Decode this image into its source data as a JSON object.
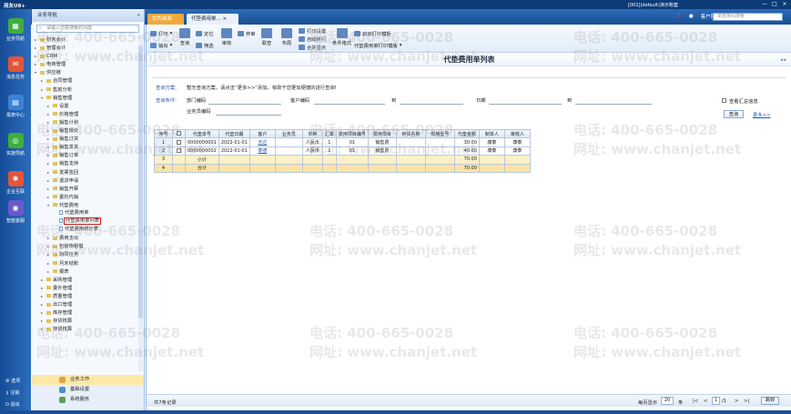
{
  "window": {
    "app_name": "用友U8+",
    "context": "[001](default)演示账套",
    "controls": [
      "—",
      "□",
      "×"
    ]
  },
  "topnav": {
    "tabs": [
      {
        "label": "我的桌面",
        "active": false
      },
      {
        "label": "代垫费用单... ×",
        "active": true
      }
    ],
    "messages_label": "客户服务",
    "search_placeholder": "单据条码搜索"
  },
  "iconbar": {
    "items": [
      {
        "label": "业务导航",
        "icon": "grid-icon",
        "color": "#3fae3f",
        "glyph": "▦"
      },
      {
        "label": "消息任务",
        "icon": "mail-icon",
        "color": "#e2553a",
        "glyph": "✉"
      },
      {
        "label": "报表中心",
        "icon": "report-icon",
        "color": "#3b82d6",
        "glyph": "▤"
      },
      {
        "label": "实施导航",
        "icon": "compass-icon",
        "color": "#3fae3f",
        "glyph": "◎"
      },
      {
        "label": "企业互联",
        "icon": "network-icon",
        "color": "#e2553a",
        "glyph": "✱"
      },
      {
        "label": "智能客服",
        "icon": "service-icon",
        "color": "#6a5acd",
        "glyph": "◉"
      }
    ],
    "bottom": [
      {
        "label": "选项",
        "icon": "gear-icon"
      },
      {
        "label": "注销",
        "icon": "key-icon"
      },
      {
        "label": "退出",
        "icon": "exit-icon"
      }
    ]
  },
  "tree": {
    "header": "业务导航",
    "search_placeholder": "请输入您要搜索的功能",
    "items": [
      {
        "label": "财务会计",
        "level": 1,
        "type": "node"
      },
      {
        "label": "管理会计",
        "level": 1,
        "type": "node"
      },
      {
        "label": "CRM",
        "level": 1,
        "type": "node"
      },
      {
        "label": "电商管理",
        "level": 1,
        "type": "node"
      },
      {
        "label": "供应链",
        "level": 1,
        "type": "open"
      },
      {
        "label": "合同管理",
        "level": 2,
        "type": "node"
      },
      {
        "label": "售前分析",
        "level": 2,
        "type": "node"
      },
      {
        "label": "销售管理",
        "level": 2,
        "type": "open"
      },
      {
        "label": "设置",
        "level": 3,
        "type": "node"
      },
      {
        "label": "价格管理",
        "level": 3,
        "type": "node"
      },
      {
        "label": "销售计划",
        "level": 3,
        "type": "node"
      },
      {
        "label": "销售报价",
        "level": 3,
        "type": "node"
      },
      {
        "label": "销售订货",
        "level": 3,
        "type": "node"
      },
      {
        "label": "销售发货",
        "level": 3,
        "type": "node"
      },
      {
        "label": "销售订单",
        "level": 3,
        "type": "node"
      },
      {
        "label": "销售支持",
        "level": 3,
        "type": "node"
      },
      {
        "label": "发票签回",
        "level": 3,
        "type": "node"
      },
      {
        "label": "退货申请",
        "level": 3,
        "type": "node"
      },
      {
        "label": "销售开票",
        "level": 3,
        "type": "node"
      },
      {
        "label": "委托代销",
        "level": 3,
        "type": "node"
      },
      {
        "label": "代垫费用",
        "level": 3,
        "type": "open"
      },
      {
        "label": "代垫费用单",
        "level": 4,
        "type": "doc"
      },
      {
        "label": "代垫费用单列表",
        "level": 4,
        "type": "doc",
        "selected": true
      },
      {
        "label": "代垫费用统计表",
        "level": 4,
        "type": "doc"
      },
      {
        "label": "费用支出",
        "level": 3,
        "type": "node"
      },
      {
        "label": "包装物租借",
        "level": 3,
        "type": "node"
      },
      {
        "label": "协同任务",
        "level": 3,
        "type": "node"
      },
      {
        "label": "月末结账",
        "level": 3,
        "type": "node"
      },
      {
        "label": "报表",
        "level": 3,
        "type": "node"
      },
      {
        "label": "采购管理",
        "level": 2,
        "type": "node"
      },
      {
        "label": "委外管理",
        "level": 2,
        "type": "node"
      },
      {
        "label": "质量管理",
        "level": 2,
        "type": "node"
      },
      {
        "label": "出口管理",
        "level": 2,
        "type": "node"
      },
      {
        "label": "库存管理",
        "level": 2,
        "type": "node"
      },
      {
        "label": "存货核算",
        "level": 2,
        "type": "node"
      },
      {
        "label": "存货核算",
        "level": 2,
        "type": "node"
      }
    ],
    "footer": [
      {
        "label": "业务工作",
        "active": true,
        "color": "#e6a23c"
      },
      {
        "label": "基础设置",
        "active": false,
        "color": "#4a90d9"
      },
      {
        "label": "系统服务",
        "active": false,
        "color": "#5aa05a"
      }
    ]
  },
  "toolbar": {
    "print": "打印",
    "output": "输出",
    "query": "查询",
    "locate": "定位",
    "filter": "筛选",
    "approve": "审核",
    "abandon": "弃审",
    "batch": "联查",
    "layout": "布局",
    "print_settings": "打印设置",
    "auto_wrap": "自动折行",
    "merge_display": "合并显示",
    "format": "条件格式",
    "print_template": "启动打印模板",
    "list_template": "代垫费用单打印模版"
  },
  "page": {
    "title": "代垫费用单列表",
    "controls": "◂ ▸"
  },
  "query": {
    "plan_label": "查询方案:",
    "plan_hint": "暂无查询方案，请点击“更多>>”添加，有助于您更加便捷的进行查询!",
    "cond_label": "查询条件:",
    "dept_label": "部门编码",
    "customer_label": "客户编码",
    "to1": "到",
    "date_label": "日期",
    "to2": "到",
    "staff_label": "业务员编码",
    "summary_label": "查看汇总信息",
    "search_btn": "查询",
    "more_link": "更多>>"
  },
  "grid": {
    "columns": [
      "序号",
      "",
      "代垫单号",
      "代垫日期",
      "客户",
      "业务员",
      "币种",
      "汇率",
      "费用项目编号",
      "费用项目",
      "存货名称",
      "规格型号",
      "代垫金额",
      "制单人",
      "审核人"
    ],
    "rows": [
      {
        "no": "1",
        "cb": true,
        "doc": "0000000001",
        "date": "2022-01-01",
        "customer": "苏达",
        "staff": "",
        "currency": "人民币",
        "rate": "1",
        "item_no": "01",
        "item": "销售费",
        "inv": "",
        "spec": "",
        "amount": "30.00",
        "maker": "康泰",
        "auditor": "康泰"
      },
      {
        "no": "2",
        "cb": true,
        "doc": "0000000002",
        "date": "2022-01-01",
        "customer": "泰德",
        "staff": "",
        "currency": "人民币",
        "rate": "1",
        "item_no": "01",
        "item": "销售费",
        "inv": "",
        "spec": "",
        "amount": "40.00",
        "maker": "康泰",
        "auditor": "康泰"
      },
      {
        "no": "3",
        "cb": false,
        "doc": "小计",
        "date": "",
        "customer": "",
        "staff": "",
        "currency": "",
        "rate": "",
        "item_no": "",
        "item": "",
        "inv": "",
        "spec": "",
        "amount": "70.00",
        "maker": "",
        "auditor": ""
      },
      {
        "no": "4",
        "cb": false,
        "doc": "合计",
        "date": "",
        "customer": "",
        "staff": "",
        "currency": "",
        "rate": "",
        "item_no": "",
        "item": "",
        "inv": "",
        "spec": "",
        "amount": "70.00",
        "maker": "",
        "auditor": ""
      }
    ]
  },
  "status": {
    "records": "共7条记录",
    "per_page_label": "每页显示",
    "per_page": "20",
    "unit": "条",
    "first": "|<",
    "prev": "<",
    "page": "1",
    "pages": "/1",
    "next": ">",
    "last": ">|",
    "jump": "跳转"
  },
  "watermarks": {
    "phone": "电话: 400-665-0028",
    "url": "网址: www.chanjet.net"
  }
}
